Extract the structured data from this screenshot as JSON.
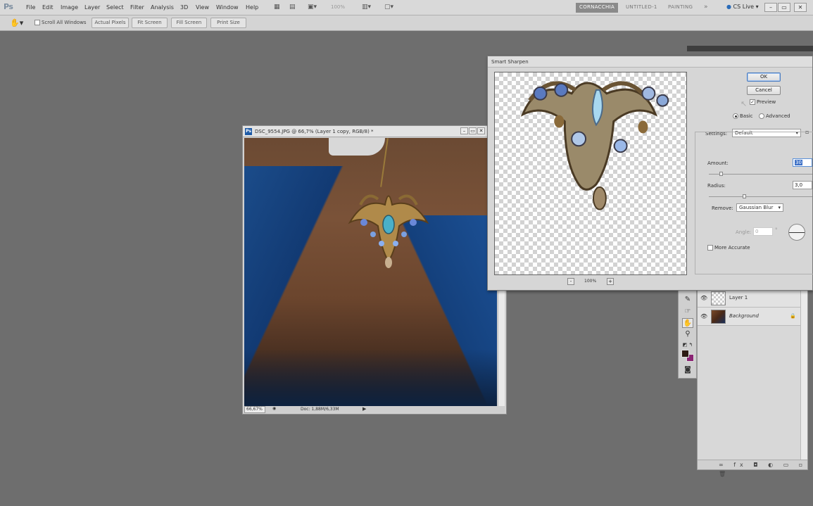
{
  "app": {
    "logo": "Ps",
    "menu": [
      "File",
      "Edit",
      "Image",
      "Layer",
      "Select",
      "Filter",
      "Analysis",
      "3D",
      "View",
      "Window",
      "Help"
    ],
    "zoom": "100%",
    "workspaces": {
      "active": "CORNACCHIA",
      "others": [
        "UNTITLED-1",
        "PAINTING"
      ],
      "more": "»"
    },
    "cs_live": "CS Live ▾",
    "win_controls": [
      "–",
      "▭",
      "✕"
    ]
  },
  "options_bar": {
    "tool_icon": "hand-icon",
    "scroll_all_windows": "Scroll All Windows",
    "buttons": [
      "Actual Pixels",
      "Fit Screen",
      "Fill Screen",
      "Print Size"
    ]
  },
  "document": {
    "badge": "Ps",
    "title": "DSC_9554.JPG @ 66,7% (Layer 1 copy, RGB/8) *",
    "zoom": "66,67%",
    "doc_info": "Doc: 1,88M/6,33M"
  },
  "dialog": {
    "title": "Smart Sharpen",
    "ok": "OK",
    "cancel": "Cancel",
    "preview_label": "Preview",
    "preview_checked": true,
    "mode_basic": "Basic",
    "mode_advanced": "Advanced",
    "settings_label": "Settings:",
    "settings_value": "Default",
    "amount_label": "Amount:",
    "amount_value": "30",
    "radius_label": "Radius:",
    "radius_value": "3,0",
    "remove_label": "Remove:",
    "remove_value": "Gaussian Blur",
    "angle_label": "Angle:",
    "angle_value": "0",
    "more_accurate": "More Accurate",
    "preview_zoom": "100%",
    "zoom_minus": "-",
    "zoom_plus": "+"
  },
  "layers": [
    {
      "name": "Layer 1",
      "locked": false
    },
    {
      "name": "Background",
      "locked": true
    }
  ],
  "colors": {
    "foreground": "#2d1c14",
    "background": "#8b2474",
    "workspace_active": "#8a8a8a"
  }
}
